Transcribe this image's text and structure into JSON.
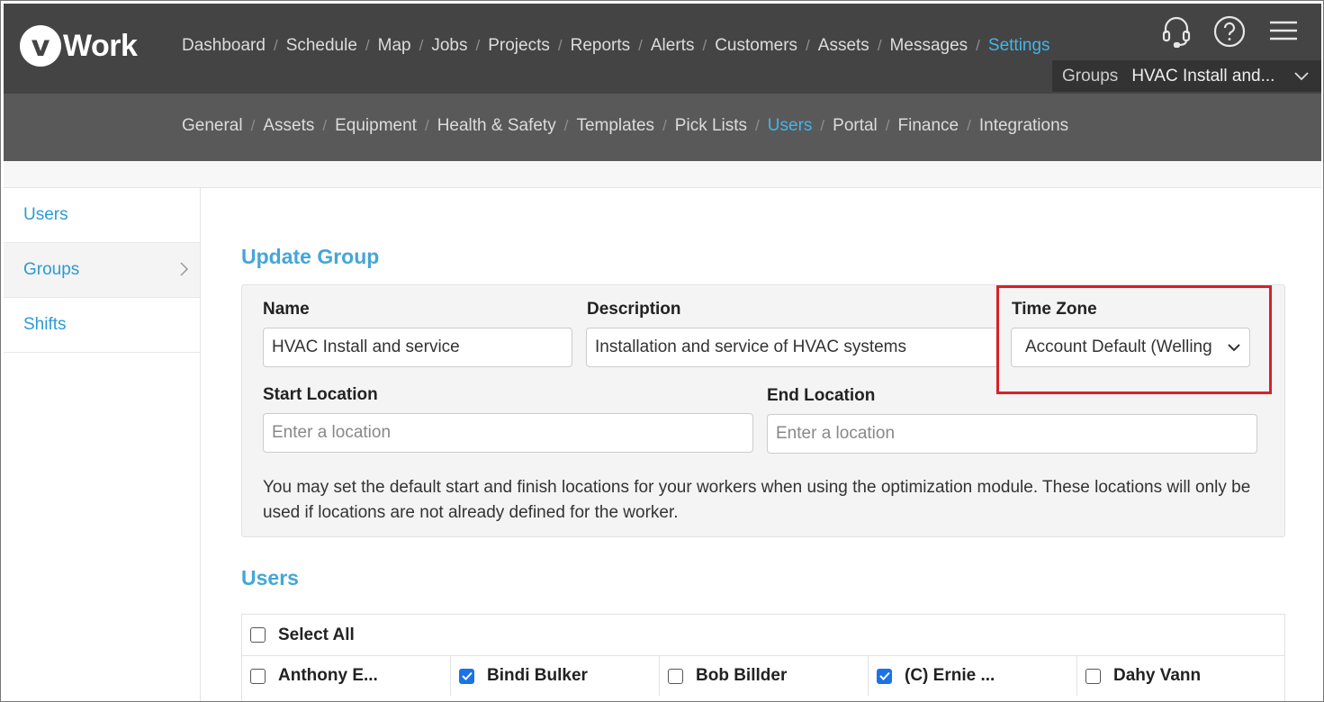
{
  "brand": {
    "logo_letter": "v",
    "name": "Work"
  },
  "main_nav": [
    {
      "label": "Dashboard",
      "active": false
    },
    {
      "label": "Schedule",
      "active": false
    },
    {
      "label": "Map",
      "active": false
    },
    {
      "label": "Jobs",
      "active": false
    },
    {
      "label": "Projects",
      "active": false
    },
    {
      "label": "Reports",
      "active": false
    },
    {
      "label": "Alerts",
      "active": false
    },
    {
      "label": "Customers",
      "active": false
    },
    {
      "label": "Assets",
      "active": false
    },
    {
      "label": "Messages",
      "active": false
    },
    {
      "label": "Settings",
      "active": true
    }
  ],
  "nav_separator": "/",
  "header_icons": [
    "headset-icon",
    "help-icon",
    "hamburger-menu-icon"
  ],
  "group_switcher": {
    "label": "Groups",
    "value": "HVAC Install and..."
  },
  "settings_nav": [
    {
      "label": "General",
      "active": false
    },
    {
      "label": "Assets",
      "active": false
    },
    {
      "label": "Equipment",
      "active": false
    },
    {
      "label": "Health & Safety",
      "active": false
    },
    {
      "label": "Templates",
      "active": false
    },
    {
      "label": "Pick Lists",
      "active": false
    },
    {
      "label": "Users",
      "active": true
    },
    {
      "label": "Portal",
      "active": false
    },
    {
      "label": "Finance",
      "active": false
    },
    {
      "label": "Integrations",
      "active": false
    }
  ],
  "sidebar": {
    "items": [
      {
        "label": "Users"
      },
      {
        "label": "Groups"
      },
      {
        "label": "Shifts"
      }
    ]
  },
  "form": {
    "title": "Update Group",
    "name_label": "Name",
    "name_value": "HVAC Install and service",
    "description_label": "Description",
    "description_value": "Installation and service of HVAC systems",
    "timezone_label": "Time Zone",
    "timezone_value": "Account Default (Welling",
    "start_location_label": "Start Location",
    "start_location_placeholder": "Enter a location",
    "end_location_label": "End Location",
    "end_location_placeholder": "Enter a location",
    "help_text": "You may set the default start and finish locations for your workers when using the optimization module. These locations will only be used if locations are not already defined for the worker."
  },
  "users_section": {
    "title": "Users",
    "select_all_label": "Select All",
    "users": [
      {
        "name": "Anthony E...",
        "checked": false
      },
      {
        "name": "Bindi Bulker",
        "checked": true
      },
      {
        "name": "Bob Billder",
        "checked": false
      },
      {
        "name": "(C) Ernie ...",
        "checked": true
      },
      {
        "name": "Dahy Vann",
        "checked": false
      }
    ]
  },
  "colors": {
    "accent": "#45b4ea",
    "highlight": "#d9202a",
    "topbar": "#444444",
    "subbar": "#595959"
  }
}
